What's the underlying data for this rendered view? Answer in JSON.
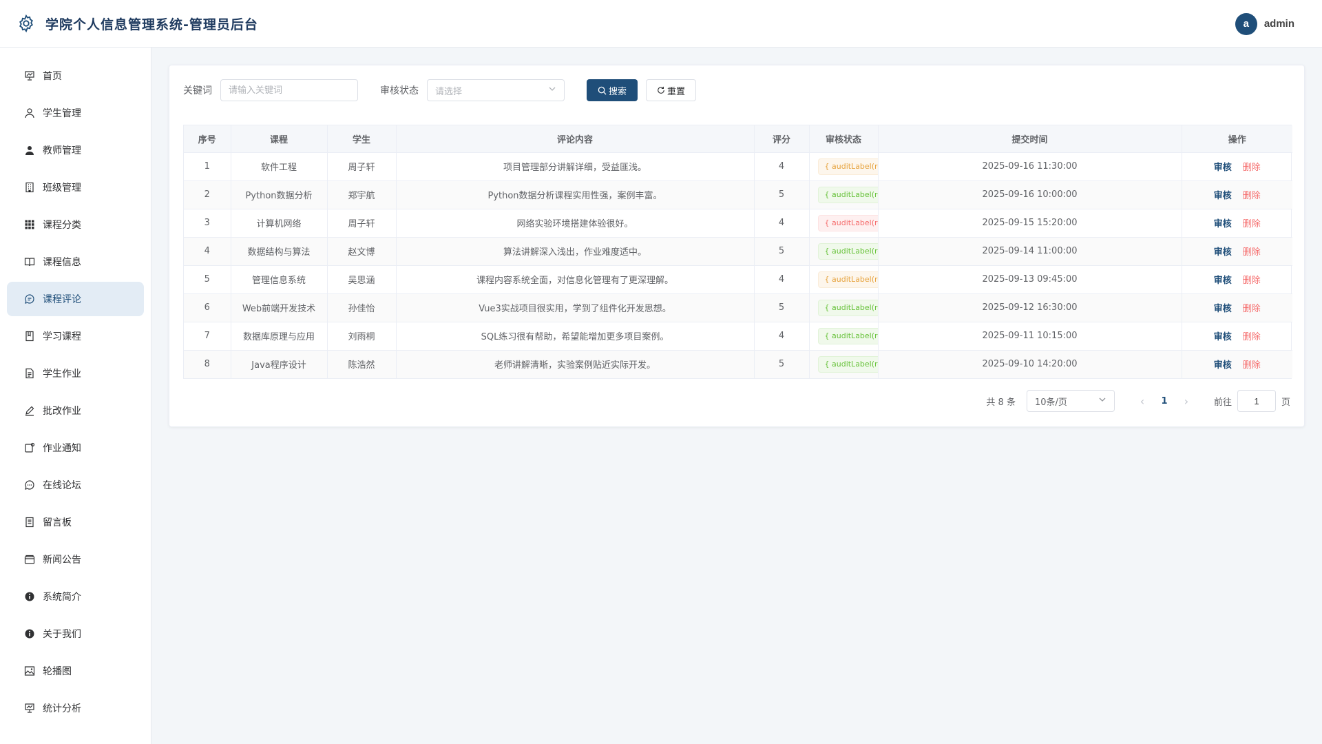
{
  "header": {
    "title": "学院个人信息管理系统-管理员后台",
    "logo_icon": "gear-icon",
    "avatar_letter": "a",
    "username": "admin"
  },
  "sidebar": {
    "items": [
      {
        "label": "首页",
        "icon": "presentation-icon"
      },
      {
        "label": "学生管理",
        "icon": "user-outline-icon"
      },
      {
        "label": "教师管理",
        "icon": "user-filled-icon"
      },
      {
        "label": "班级管理",
        "icon": "building-icon"
      },
      {
        "label": "课程分类",
        "icon": "grid-icon"
      },
      {
        "label": "课程信息",
        "icon": "book-icon"
      },
      {
        "label": "课程评论",
        "icon": "chat-bubble-icon",
        "active": true
      },
      {
        "label": "学习课程",
        "icon": "notebook-icon"
      },
      {
        "label": "学生作业",
        "icon": "document-icon"
      },
      {
        "label": "批改作业",
        "icon": "pen-icon"
      },
      {
        "label": "作业通知",
        "icon": "notification-icon"
      },
      {
        "label": "在线论坛",
        "icon": "chat-dots-icon"
      },
      {
        "label": "留言板",
        "icon": "memo-icon"
      },
      {
        "label": "新闻公告",
        "icon": "wallet-icon"
      },
      {
        "label": "系统简介",
        "icon": "info-icon"
      },
      {
        "label": "关于我们",
        "icon": "info-icon"
      },
      {
        "label": "轮播图",
        "icon": "picture-icon"
      },
      {
        "label": "统计分析",
        "icon": "presentation-icon"
      },
      {
        "label": "",
        "icon": "more-icon"
      }
    ]
  },
  "filters": {
    "keyword_label": "关键词",
    "keyword_placeholder": "请输入关键词",
    "status_label": "审核状态",
    "status_placeholder": "请选择",
    "search_button": "搜索",
    "reset_button": "重置"
  },
  "table": {
    "columns": [
      "序号",
      "课程",
      "学生",
      "评论内容",
      "评分",
      "审核状态",
      "提交时间",
      "操作"
    ],
    "audit_label": "审核",
    "delete_label": "删除",
    "rows": [
      {
        "no": "1",
        "course": "软件工程",
        "student": "周子轩",
        "content": "项目管理部分讲解详细，受益匪浅。",
        "score": "4",
        "status": "{ auditLabel(ro",
        "status_color": "warning",
        "time": "2025-09-16 11:30:00"
      },
      {
        "no": "2",
        "course": "Python数据分析",
        "student": "郑宇航",
        "content": "Python数据分析课程实用性强，案例丰富。",
        "score": "5",
        "status": "{ auditLabel(ro",
        "status_color": "success",
        "time": "2025-09-16 10:00:00"
      },
      {
        "no": "3",
        "course": "计算机网络",
        "student": "周子轩",
        "content": "网络实验环境搭建体验很好。",
        "score": "4",
        "status": "{ auditLabel(ro",
        "status_color": "danger",
        "time": "2025-09-15 15:20:00"
      },
      {
        "no": "4",
        "course": "数据结构与算法",
        "student": "赵文博",
        "content": "算法讲解深入浅出，作业难度适中。",
        "score": "5",
        "status": "{ auditLabel(ro",
        "status_color": "success",
        "time": "2025-09-14 11:00:00"
      },
      {
        "no": "5",
        "course": "管理信息系统",
        "student": "吴思涵",
        "content": "课程内容系统全面，对信息化管理有了更深理解。",
        "score": "4",
        "status": "{ auditLabel(ro",
        "status_color": "warning",
        "time": "2025-09-13 09:45:00"
      },
      {
        "no": "6",
        "course": "Web前端开发技术",
        "student": "孙佳怡",
        "content": "Vue3实战项目很实用，学到了组件化开发思想。",
        "score": "5",
        "status": "{ auditLabel(ro",
        "status_color": "success",
        "time": "2025-09-12 16:30:00"
      },
      {
        "no": "7",
        "course": "数据库原理与应用",
        "student": "刘雨桐",
        "content": "SQL练习很有帮助，希望能增加更多项目案例。",
        "score": "4",
        "status": "{ auditLabel(ro",
        "status_color": "success",
        "time": "2025-09-11 10:15:00"
      },
      {
        "no": "8",
        "course": "Java程序设计",
        "student": "陈浩然",
        "content": "老师讲解清晰，实验案例贴近实际开发。",
        "score": "5",
        "status": "{ auditLabel(ro",
        "status_color": "success",
        "time": "2025-09-10 14:20:00"
      }
    ]
  },
  "pagination": {
    "total_text": "共 8 条",
    "page_size": "10条/页",
    "current_page": "1",
    "goto_label": "前往",
    "goto_value": "1",
    "page_suffix": "页"
  },
  "colors": {
    "primary": "#1f4e79",
    "warning": "#e6a23c",
    "success": "#67c23a",
    "danger": "#f56c6c"
  }
}
